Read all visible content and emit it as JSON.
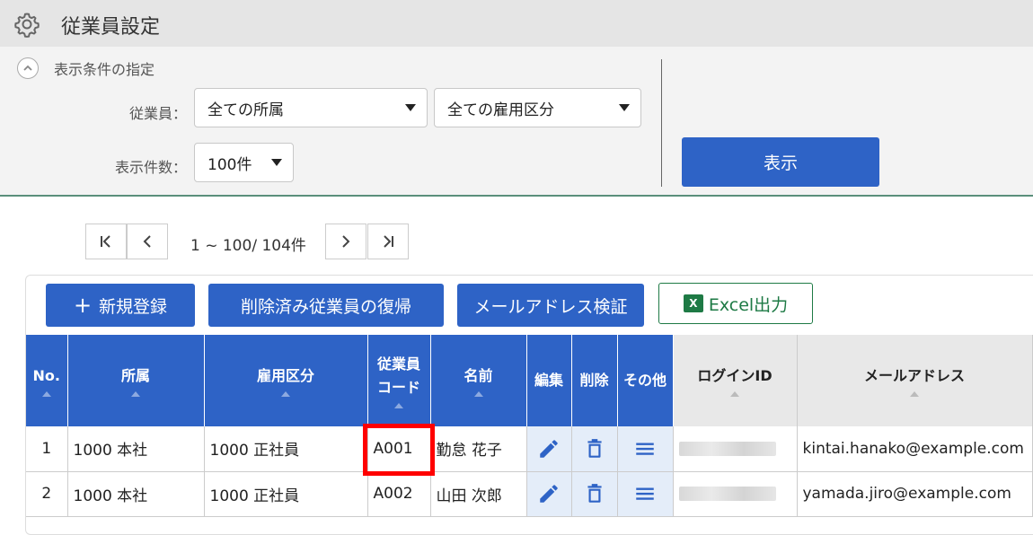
{
  "header": {
    "title": "従業員設定",
    "icon": "gear-icon"
  },
  "filter": {
    "section_title": "表示条件の指定",
    "employee_label": "従業員：",
    "affiliation_value": "全ての所属",
    "employment_value": "全ての雇用区分",
    "count_label": "表示件数：",
    "count_value": "100件",
    "show_button": "表示"
  },
  "pager": {
    "text": "1 ~ 100/ 104件"
  },
  "actions": {
    "new_button": "新規登録",
    "restore_button": "削除済み従業員の復帰",
    "verify_button": "メールアドレス検証",
    "excel_button": "Excel出力",
    "excel_badge": "X"
  },
  "table": {
    "headers": {
      "no": "No.",
      "affiliation": "所属",
      "employment": "雇用区分",
      "code_line1": "従業員",
      "code_line2": "コード",
      "name": "名前",
      "edit": "編集",
      "delete": "削除",
      "other": "その他",
      "login": "ログインID",
      "email": "メールアドレス"
    },
    "rows": [
      {
        "no": "1",
        "affiliation": "1000 本社",
        "employment": "1000 正社員",
        "code": "A001",
        "name": "勤怠 花子",
        "email": "kintai.hanako@example.com"
      },
      {
        "no": "2",
        "affiliation": "1000 本社",
        "employment": "1000 正社員",
        "code": "A002",
        "name": "山田 次郎",
        "email": "yamada.jiro@example.com"
      }
    ]
  },
  "colors": {
    "accent": "#2e63c6",
    "excel": "#1e7a45",
    "highlight": "#ff0000",
    "action_bg": "#e4edf9"
  }
}
